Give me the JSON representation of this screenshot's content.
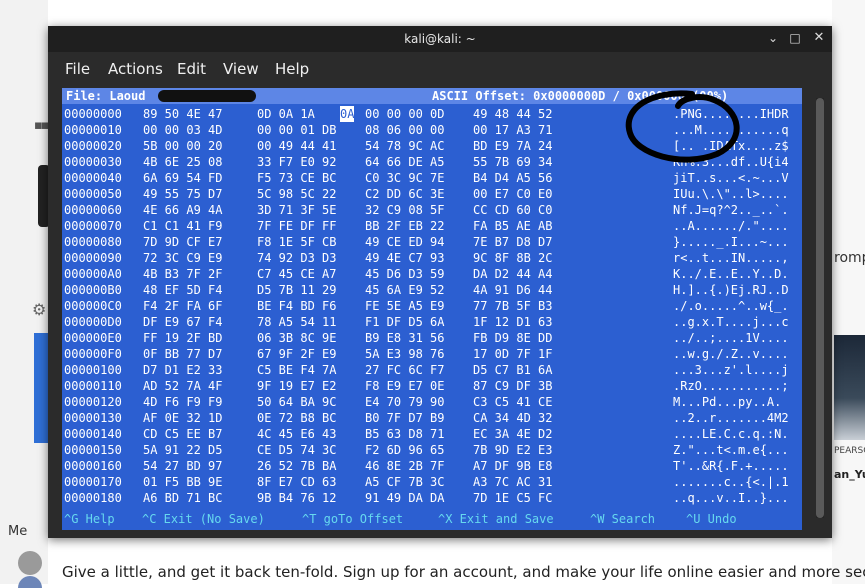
{
  "background": {
    "grid_icon": "▪▪▪",
    "gear_icon": "⚙",
    "right_word": "romp",
    "right_caption_1": "PEARSO",
    "right_caption_2": "an_Yu",
    "message_row": "Me",
    "promo_text": "Give a little, and get it back ten-fold. Sign up for an account, and make your life online easier and more secure."
  },
  "window": {
    "title": "kali@kali: ~",
    "minimize_icon": "⌄",
    "maximize_icon": "□",
    "close_icon": "✕"
  },
  "menu": {
    "file": "File",
    "actions": "Actions",
    "edit": "Edit",
    "view": "View",
    "help": "Help"
  },
  "editor": {
    "status_left": "File: Laoud",
    "status_right": "ASCII Offset: 0x0000000D / 0x000000 (00%)",
    "cursor_byte": "0A",
    "rows": [
      {
        "offset": "00000000",
        "g1": "89 50 4E 47",
        "g2": "0D 0A 1A",
        "cur": "0A",
        "g3": "00 00 00 0D",
        "g4": "49 48 44 52",
        "ascii": ".PNG........IHDR"
      },
      {
        "offset": "00000010",
        "g1": "00 00 03 4D",
        "g2": "00 00 01 DB",
        "g3": "08 06 00 00",
        "g4": "00 17 A3 71",
        "ascii": "...M...........q"
      },
      {
        "offset": "00000020",
        "g1": "5B 00 00 20",
        "g2": "00 49 44 41",
        "g3": "54 78 9C AC",
        "g4": "BD E9 7A 24",
        "ascii": "[.. .IDATx....z$"
      },
      {
        "offset": "00000030",
        "g1": "4B 6E 25 08",
        "g2": "33 F7 E0 92",
        "g3": "64 66 DE A5",
        "g4": "55 7B 69 34",
        "ascii": "Kn%.3...df..U{i4"
      },
      {
        "offset": "00000040",
        "g1": "6A 69 54 FD",
        "g2": "F5 73 CE BC",
        "g3": "C0 3C 9C 7E",
        "g4": "B4 D4 A5 56",
        "ascii": "jiT..s...<.~...V"
      },
      {
        "offset": "00000050",
        "g1": "49 55 75 D7",
        "g2": "5C 98 5C 22",
        "g3": "C2 DD 6C 3E",
        "g4": "00 E7 C0 E0",
        "ascii": "IUu.\\.\\\"..l>...."
      },
      {
        "offset": "00000060",
        "g1": "4E 66 A9 4A",
        "g2": "3D 71 3F 5E",
        "g3": "32 C9 08 5F",
        "g4": "CC CD 60 C0",
        "ascii": "Nf.J=q?^2.._..`."
      },
      {
        "offset": "00000070",
        "g1": "C1 C1 41 F9",
        "g2": "7F FE DF FF",
        "g3": "BB 2F EB 22",
        "g4": "FA B5 AE AB",
        "ascii": "..A....../.\"...."
      },
      {
        "offset": "00000080",
        "g1": "7D 9D CF E7",
        "g2": "F8 1E 5F CB",
        "g3": "49 CE ED 94",
        "g4": "7E B7 D8 D7",
        "ascii": "}....._.I...~..."
      },
      {
        "offset": "00000090",
        "g1": "72 3C C9 E9",
        "g2": "74 92 D3 D3",
        "g3": "49 4E C7 93",
        "g4": "9C 8F 8B 2C",
        "ascii": "r<..t...IN.....,"
      },
      {
        "offset": "000000A0",
        "g1": "4B B3 7F 2F",
        "g2": "C7 45 CE A7",
        "g3": "45 D6 D3 59",
        "g4": "DA D2 44 A4",
        "ascii": "K../.E..E..Y..D."
      },
      {
        "offset": "000000B0",
        "g1": "48 EF 5D F4",
        "g2": "D5 7B 11 29",
        "g3": "45 6A E9 52",
        "g4": "4A 91 D6 44",
        "ascii": "H.]..{.)Ej.RJ..D"
      },
      {
        "offset": "000000C0",
        "g1": "F4 2F FA 6F",
        "g2": "BE F4 BD F6",
        "g3": "FE 5E A5 E9",
        "g4": "77 7B 5F B3",
        "ascii": "./.o.....^..w{_."
      },
      {
        "offset": "000000D0",
        "g1": "DF E9 67 F4",
        "g2": "78 A5 54 11",
        "g3": "F1 DF D5 6A",
        "g4": "1F 12 D1 63",
        "ascii": "..g.x.T....j...c"
      },
      {
        "offset": "000000E0",
        "g1": "FF 19 2F BD",
        "g2": "06 3B 8C 9E",
        "g3": "B9 E8 31 56",
        "g4": "FB D9 8E DD",
        "ascii": "../..;....1V...."
      },
      {
        "offset": "000000F0",
        "g1": "0F BB 77 D7",
        "g2": "67 9F 2F E9",
        "g3": "5A E3 98 76",
        "g4": "17 0D 7F 1F",
        "ascii": "..w.g./.Z..v...."
      },
      {
        "offset": "00000100",
        "g1": "D7 D1 E2 33",
        "g2": "C5 BE F4 7A",
        "g3": "27 FC 6C F7",
        "g4": "D5 C7 B1 6A",
        "ascii": "...3...z'.l....j"
      },
      {
        "offset": "00000110",
        "g1": "AD 52 7A 4F",
        "g2": "9F 19 E7 E2",
        "g3": "F8 E9 E7 0E",
        "g4": "87 C9 DF 3B",
        "ascii": ".RzO...........;"
      },
      {
        "offset": "00000120",
        "g1": "4D F6 F9 F9",
        "g2": "50 64 BA 9C",
        "g3": "E4 70 79 90",
        "g4": "C3 C5 41 CE",
        "ascii": "M...Pd...py..A."
      },
      {
        "offset": "00000130",
        "g1": "AF 0E 32 1D",
        "g2": "0E 72 B8 BC",
        "g3": "B0 7F D7 B9",
        "g4": "CA 34 4D 32",
        "ascii": "..2..r.......4M2"
      },
      {
        "offset": "00000140",
        "g1": "CD C5 EE B7",
        "g2": "4C 45 E6 43",
        "g3": "B5 63 D8 71",
        "g4": "EC 3A 4E D2",
        "ascii": "....LE.C.c.q.:N."
      },
      {
        "offset": "00000150",
        "g1": "5A 91 22 D5",
        "g2": "CE D5 74 3C",
        "g3": "F2 6D 96 65",
        "g4": "7B 9D E2 E3",
        "ascii": "Z.\"...t<.m.e{..."
      },
      {
        "offset": "00000160",
        "g1": "54 27 BD 97",
        "g2": "26 52 7B BA",
        "g3": "46 8E 2B 7F",
        "g4": "A7 DF 9B E8",
        "ascii": "T'..&R{.F.+....."
      },
      {
        "offset": "00000170",
        "g1": "01 F5 BB 9E",
        "g2": "8F E7 CD 63",
        "g3": "A5 CF 7B 3C",
        "g4": "A3 7C AC 31",
        "ascii": ".......c..{<.|.1"
      },
      {
        "offset": "00000180",
        "g1": "A6 BD 71 BC",
        "g2": "9B B4 76 12",
        "g3": "91 49 DA DA",
        "g4": "7D 1E C5 FC",
        "ascii": "..q...v..I..}..."
      }
    ],
    "shortcuts": {
      "help": "^G Help",
      "exit": "^C Exit (No Save)",
      "goto": "^T goTo Offset",
      "save": "^X Exit and Save",
      "search": "^W Search",
      "undo": "^U Undo"
    }
  },
  "colors": {
    "editor_background": "#2c5fd1",
    "shortcut_text": "#66d9ef",
    "titlebar": "#1f1f1f"
  }
}
